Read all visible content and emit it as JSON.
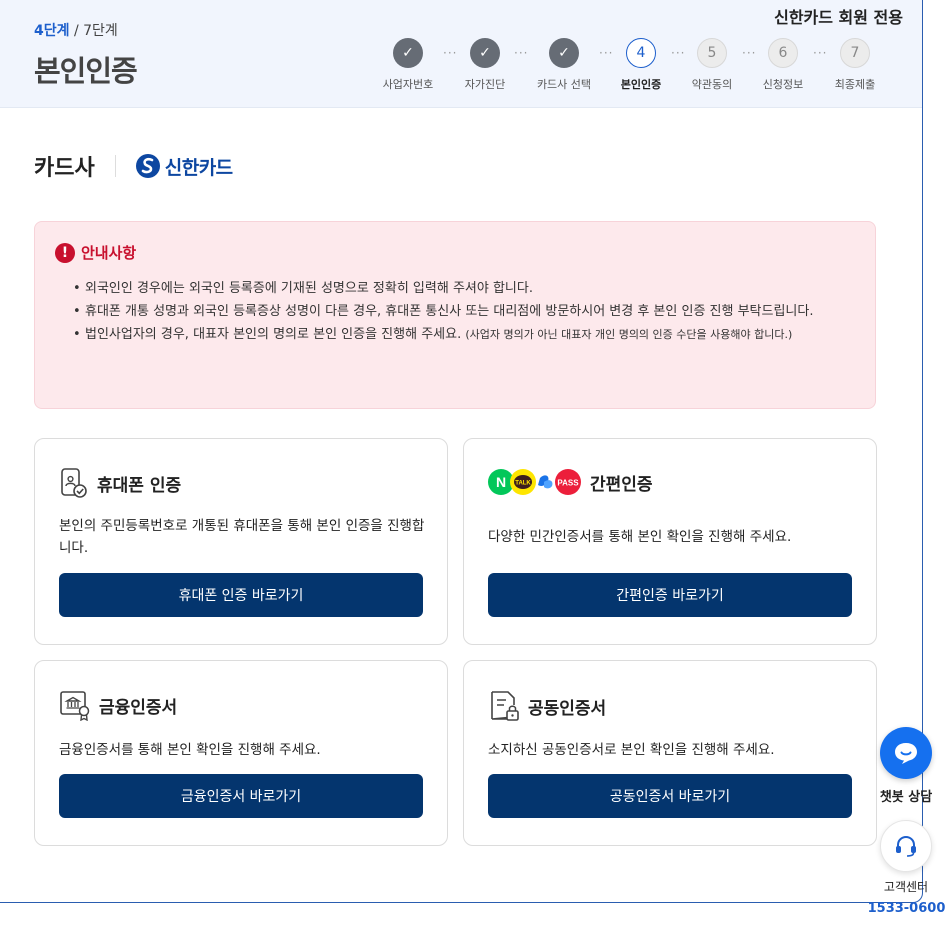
{
  "header": {
    "step_current": "4단계",
    "step_total": "/ 7단계",
    "page_title": "본인인증",
    "member_only": "신한카드 회원 전용",
    "steps": [
      {
        "num": "✓",
        "label": "사업자번호",
        "state": "done"
      },
      {
        "num": "✓",
        "label": "자가진단",
        "state": "done"
      },
      {
        "num": "✓",
        "label": "카드사 선택",
        "state": "done"
      },
      {
        "num": "4",
        "label": "본인인증",
        "state": "current"
      },
      {
        "num": "5",
        "label": "약관동의",
        "state": "todo"
      },
      {
        "num": "6",
        "label": "신청정보",
        "state": "todo"
      },
      {
        "num": "7",
        "label": "최종제출",
        "state": "todo"
      }
    ]
  },
  "company": {
    "label": "카드사",
    "brand_name": "신한카드"
  },
  "notice": {
    "title": "안내사항",
    "items": [
      "외국인인 경우에는 외국인 등록증에 기재된 성명으로 정확히 입력해 주셔야 합니다.",
      "휴대폰 개통 성명과 외국인 등록증상 성명이 다른 경우, 휴대폰 통신사 또는 대리점에 방문하시어 변경 후 본인 인증 진행 부탁드립니다.",
      "법인사업자의 경우, 대표자 본인의 명의로 본인 인증을 진행해 주세요."
    ],
    "item3_note": "(사업자 명의가 아닌 대표자 개인 명의의 인증 수단을 사용해야 합니다.)"
  },
  "auth_methods": {
    "phone": {
      "title": "휴대폰 인증",
      "desc": "본인의 주민등록번호로 개통된 휴대폰을 통해 본인 인증을 진행합니다.",
      "button": "휴대폰 인증 바로가기"
    },
    "simple": {
      "title": "간편인증",
      "desc": "다양한 민간인증서를 통해 본인 확인을 진행해 주세요.",
      "button": "간편인증 바로가기",
      "badge_naver": "N",
      "badge_kakao": "TALK",
      "badge_pass": "PASS"
    },
    "finance": {
      "title": "금융인증서",
      "desc": "금융인증서를 통해 본인 확인을 진행해 주세요.",
      "button": "금융인증서 바로가기"
    },
    "joint": {
      "title": "공동인증서",
      "desc": "소지하신 공동인증서로 본인 확인을 진행해 주세요.",
      "button": "공동인증서 바로가기"
    }
  },
  "floating": {
    "chatbot_label": "챗봇 상담",
    "center_label": "고객센터",
    "center_phone": "1533-0600"
  },
  "colors": {
    "primary_button": "#04356e",
    "accent_blue": "#1d5fcc",
    "notice_red": "#c8102e",
    "notice_bg": "#fde9ec"
  }
}
